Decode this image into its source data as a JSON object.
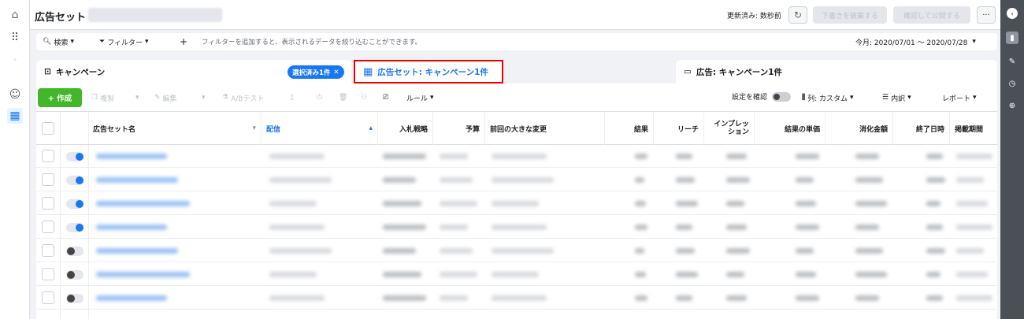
{
  "header": {
    "title": "広告セット",
    "updated": "更新済み: 数秒前",
    "discard_draft": "下書きを破棄する",
    "review_publish": "確認して公開する",
    "more": "···"
  },
  "filterbar": {
    "search": "検索",
    "filter": "フィルター",
    "add": "+",
    "hint": "フィルターを追加すると、表示されるデータを絞り込むことができます。",
    "date": "今月: 2020/07/01 〜 2020/07/28"
  },
  "tabs": {
    "campaign": "キャンペーン",
    "selected_badge": "選択済み1件",
    "adset": "広告セット: キャンペーン1件",
    "ads": "広告: キャンペーン1件"
  },
  "toolbar": {
    "create": "+ 作成",
    "duplicate": "複製",
    "edit": "編集",
    "ab_test": "A/Bテスト",
    "rules": "ルール",
    "view_settings": "設定を確認",
    "columns": "列: カスタム",
    "breakdown": "内訳",
    "reports": "レポート"
  },
  "table": {
    "columns": [
      "広告セット名",
      "配信",
      "入札戦略",
      "予算",
      "前回の大きな変更",
      "結果",
      "リーチ",
      "インプレッション",
      "結果の単価",
      "消化金額",
      "終了日時",
      "掲載期間"
    ],
    "row_toggles": [
      true,
      true,
      true,
      true,
      false,
      false,
      false
    ]
  },
  "colors": {
    "accent": "#1877f2",
    "create": "#42b72a",
    "highlight": "#e00000"
  },
  "icons": {
    "left": [
      "home-icon",
      "apps-grid-icon",
      "account-icon",
      "smile-icon",
      "table-icon"
    ],
    "right": [
      "chevron-left-icon",
      "bar-chart-icon",
      "pencil-icon",
      "clock-icon",
      "zoom-icon"
    ]
  }
}
